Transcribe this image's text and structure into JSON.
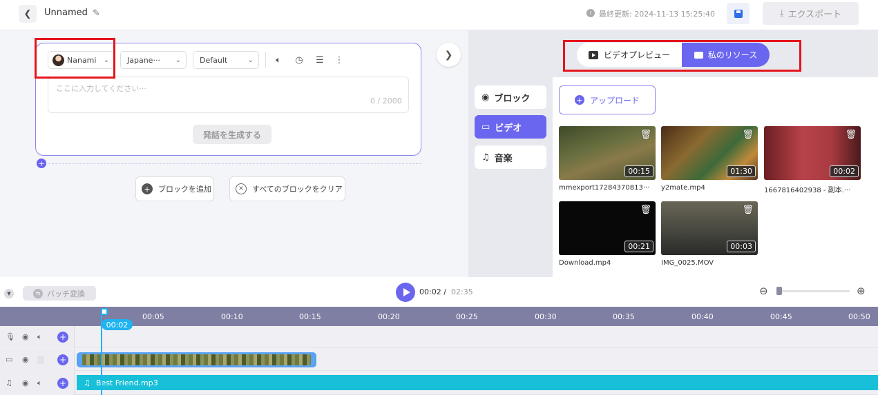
{
  "header": {
    "back_icon": "chevron-left-icon",
    "title": "Unnamed",
    "edit_icon": "pencil-icon",
    "last_updated": "最終更新: 2024-11-13 15:25:40",
    "save_icon": "floppy-disk-icon",
    "export_label": "エクスポート"
  },
  "editor": {
    "voice": "Nanami",
    "language": "Japane···",
    "style": "Default",
    "textarea_placeholder": "ここに入力してください···",
    "char_count": "0 / 2000",
    "generate_label": "発話を生成する",
    "add_block_label": "ブロックを追加",
    "clear_blocks_label": "すべてのブロックをクリア"
  },
  "right": {
    "tab_preview": "ビデオプレビュー",
    "tab_resources": "私のリソース",
    "side_block": "ブロック",
    "side_video": "ビデオ",
    "side_music": "音楽",
    "upload_label": "アップロード",
    "media": [
      {
        "name": "mmexport17284370813···",
        "duration": "00:15"
      },
      {
        "name": "y2mate.mp4",
        "duration": "01:30"
      },
      {
        "name": "1667816402938 - 副本.···",
        "duration": "00:02"
      },
      {
        "name": "Download.mp4",
        "duration": "00:21"
      },
      {
        "name": "IMG_0025.MOV",
        "duration": "00:03"
      }
    ]
  },
  "timeline": {
    "batch_label": "バッチ変換",
    "current_time": "00:02 /",
    "total_time": "02:35",
    "playhead_label": "00:02",
    "ticks": [
      "00:05",
      "00:10",
      "00:15",
      "00:20",
      "00:25",
      "00:30",
      "00:35",
      "00:40",
      "00:45",
      "00:50"
    ],
    "audio_clip": "Best Friend.mp3"
  },
  "colors": {
    "accent": "#6b66ef",
    "highlight": "#e5141c",
    "audio": "#17c0d8"
  }
}
